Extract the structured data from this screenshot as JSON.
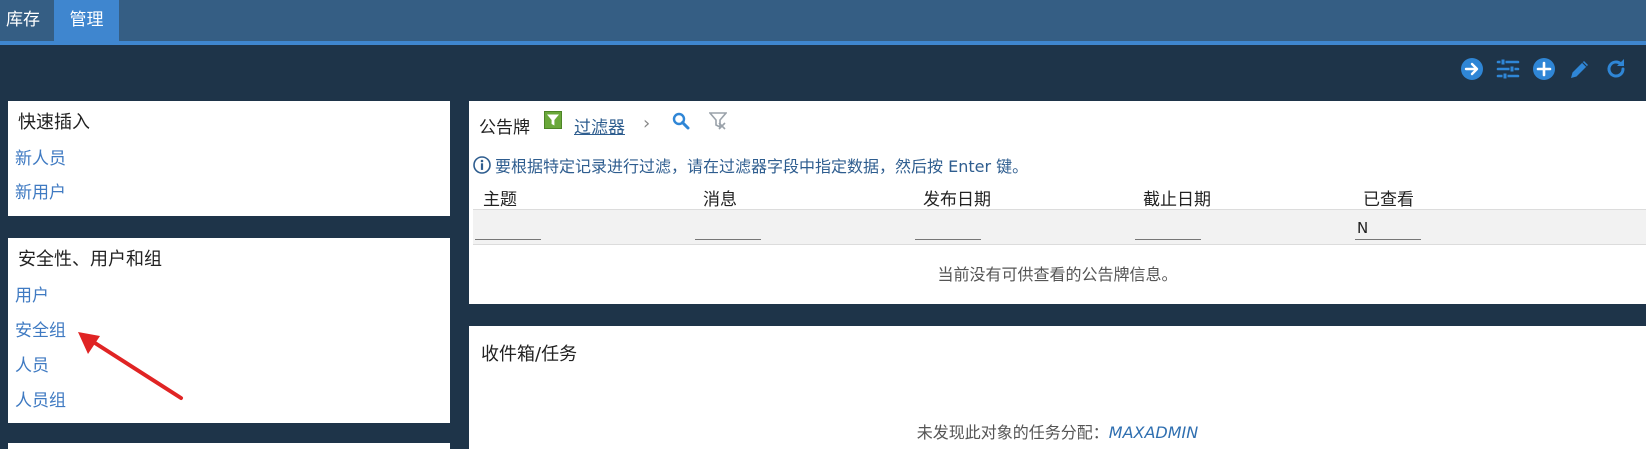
{
  "tabs": [
    {
      "label": "库存"
    },
    {
      "label": "管理"
    }
  ],
  "toolbar": {
    "icons": [
      "go-icon",
      "settings-sliders-icon",
      "add-icon",
      "edit-icon",
      "refresh-icon"
    ],
    "accent": "#2f86d6"
  },
  "quick_insert": {
    "title": "快速插入",
    "links": [
      "新人员",
      "新用户"
    ]
  },
  "security": {
    "title": "安全性、用户和组",
    "links": [
      "用户",
      "安全组",
      "人员",
      "人员组"
    ]
  },
  "bulletin": {
    "title": "公告牌",
    "filter_label": "过滤器",
    "chevron": "›",
    "info_text": "要根据特定记录进行过滤，请在过滤器字段中指定数据，然后按 Enter 键。",
    "columns": [
      "主题",
      "消息",
      "发布日期",
      "截止日期",
      "已查看"
    ],
    "filter_values": [
      "",
      "",
      "",
      "",
      "N"
    ],
    "empty_text": "当前没有可供查看的公告牌信息。"
  },
  "inbox": {
    "title": "收件箱/任务",
    "empty_prefix": "未发现此对象的任务分配：",
    "empty_user": "MAXADMIN"
  },
  "colors": {
    "background": "#1e3449",
    "tabbar": "#355e84",
    "active_tab": "#3f86cf",
    "link": "#3f7ac2",
    "annotation_arrow": "#e02424"
  }
}
